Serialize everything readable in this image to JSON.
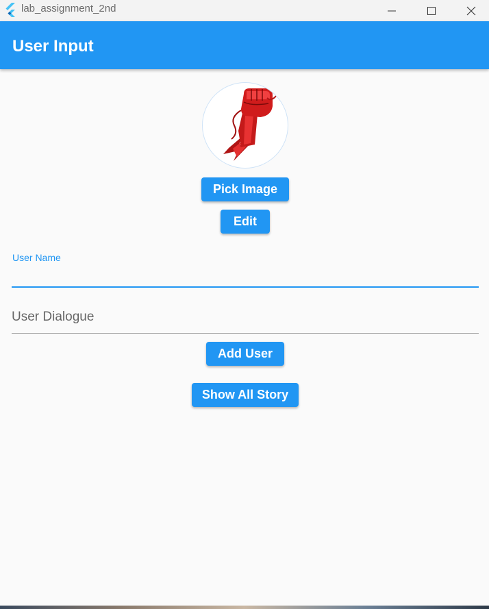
{
  "window": {
    "title": "lab_assignment_2nd"
  },
  "appbar": {
    "title": "User Input"
  },
  "avatar": {
    "image": "red-fist-lightning-logo"
  },
  "buttons": {
    "pick_image": "Pick Image",
    "edit": "Edit",
    "add_user": "Add User",
    "show_all_story": "Show All Story"
  },
  "form": {
    "user_name_label": "User Name",
    "user_name_value": "",
    "user_dialogue_placeholder": "User Dialogue",
    "user_dialogue_value": ""
  },
  "colors": {
    "primary": "#2196f3",
    "background": "#fafafa",
    "titlebar": "#f3f3f3"
  }
}
